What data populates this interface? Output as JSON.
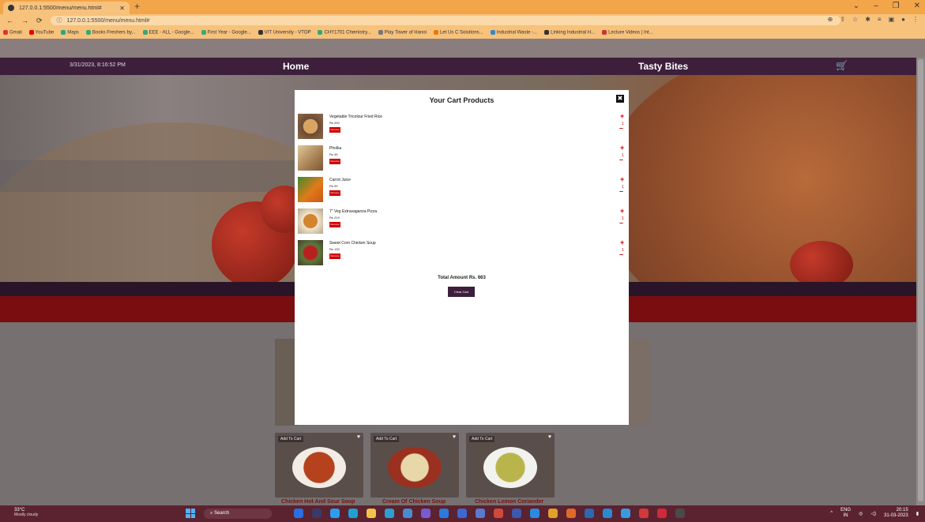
{
  "browser": {
    "tab_title": "127.0.0.1:5500/menu/menu.html#",
    "address": "127.0.0.1:5500/menu/menu.html#",
    "bookmarks": [
      "Gmail",
      "YouTube",
      "Maps",
      "Books Freshers by...",
      "EEE - ALL - Google...",
      "First Year - Google...",
      "VIT University - VTOP",
      "CHY1701 Chemistry...",
      "Play Tower of Hanoi",
      "Let Us C Solutions...",
      "Industrial Waste -...",
      "Linking Industrial H...",
      "Lecture Videos | Int..."
    ]
  },
  "header": {
    "datetime": "3/31/2023, 8:16:52 PM",
    "home": "Home",
    "brand": "Tasty Bites",
    "cart_icon": "cart-icon"
  },
  "modal": {
    "title": "Your Cart Products",
    "close_symbol": "✖",
    "remove_label": "Remove",
    "items": [
      {
        "name": "Vegetable Tricolour Fried Rice",
        "price": "Rs 200",
        "qty": "1"
      },
      {
        "name": "Pholka",
        "price": "Rs 45",
        "qty": "1"
      },
      {
        "name": "Carrot Juice",
        "price": "Rs 99",
        "qty": "1"
      },
      {
        "name": "7\" Veg Extravaganza Pizza",
        "price": "Rs 219",
        "qty": "1"
      },
      {
        "name": "Sweet Corn Chicken Soup",
        "price": "Rs 139",
        "qty": "1"
      }
    ],
    "total": "Total Amount Rs. 663",
    "clear_button": "Clear Cart"
  },
  "menu_cards": [
    {
      "badge": "Add To Cart",
      "name": "Chicken Hot And Sour Soup"
    },
    {
      "badge": "Add To Cart",
      "name": "Cream Of Chicken Soup"
    },
    {
      "badge": "Add To Cart",
      "name": "Chicken Lemon Coriander"
    }
  ],
  "taskbar": {
    "temp": "33°C",
    "condition": "Mostly cloudy",
    "search": "Search",
    "lang": "ENG",
    "region": "IN",
    "time": "20:15",
    "date": "31-03-2023"
  }
}
